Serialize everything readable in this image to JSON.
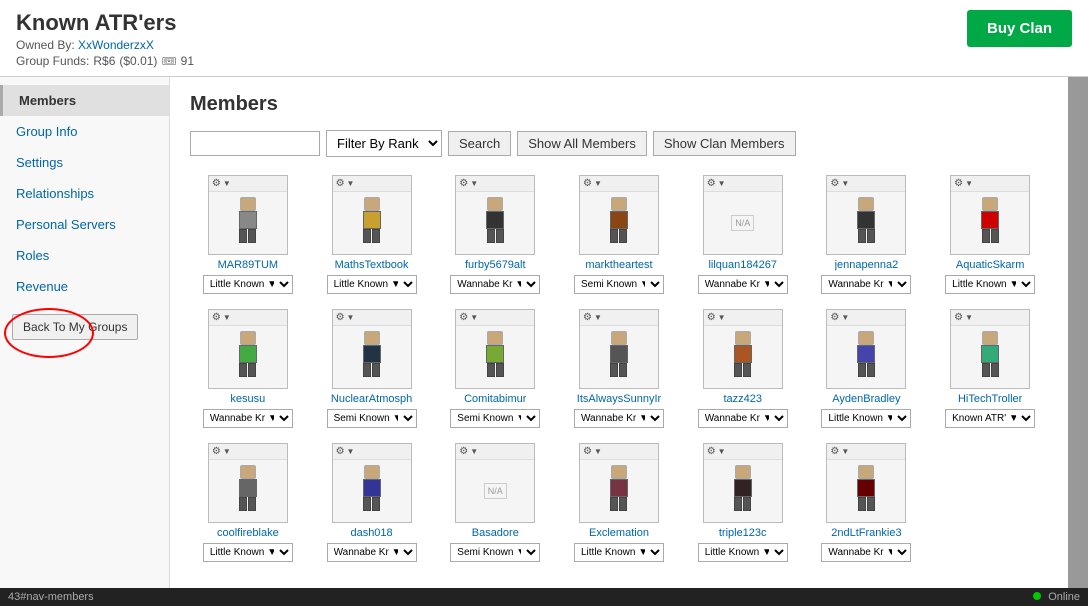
{
  "page": {
    "title": "Known ATR'ers",
    "owned_by_label": "Owned By:",
    "owned_by_user": "XxWonderzxX",
    "funds_label": "Group Funds:",
    "funds_robux": "R$6",
    "funds_usd": "($0.01)",
    "funds_tix": "91",
    "buy_clan_label": "Buy Clan"
  },
  "sidebar": {
    "items": [
      {
        "label": "Members",
        "active": true
      },
      {
        "label": "Group Info",
        "active": false
      },
      {
        "label": "Settings",
        "active": false
      },
      {
        "label": "Relationships",
        "active": false
      },
      {
        "label": "Personal Servers",
        "active": false
      },
      {
        "label": "Roles",
        "active": false
      },
      {
        "label": "Revenue",
        "active": false
      }
    ],
    "back_button_label": "Back To My Groups"
  },
  "members": {
    "title": "Members",
    "filter_placeholder": "",
    "filter_by_rank_label": "Filter By Rank",
    "search_label": "Search",
    "show_all_members_label": "Show All Members",
    "show_clan_members_label": "Show Clan Members",
    "rank_options": [
      "Little Known",
      "Wannabe Kr",
      "Semi Known",
      "Known ATR'",
      "Little Known",
      "Wannabe Kr"
    ],
    "rows": [
      {
        "members": [
          {
            "name": "MAR89TUM",
            "rank": "Little Known",
            "char_class": "char-body"
          },
          {
            "name": "MathsTextbook",
            "rank": "Little Known",
            "char_class": "char-body2"
          },
          {
            "name": "furby5679alt",
            "rank": "Wannabe Kr",
            "char_class": "char-body3"
          },
          {
            "name": "marktheartest",
            "rank": "Semi Known",
            "char_class": "char-body4"
          },
          {
            "name": "lilquan184267",
            "rank": "Wannabe Kr",
            "char_class": "char-body5",
            "na": true
          },
          {
            "name": "jennapenna2",
            "rank": "Wannabe Kr",
            "char_class": "char-body6"
          },
          {
            "name": "AquaticSkarm",
            "rank": "Little Known",
            "char_class": "char-body7"
          }
        ]
      },
      {
        "members": [
          {
            "name": "kesusu",
            "rank": "Wannabe Kr",
            "char_class": "char-body8"
          },
          {
            "name": "NuclearAtmosph",
            "rank": "Semi Known",
            "char_class": "char-body9"
          },
          {
            "name": "Comitabimur",
            "rank": "Semi Known",
            "char_class": "char-body10"
          },
          {
            "name": "ItsAlwaysSunnyIr",
            "rank": "Wannabe Kr",
            "char_class": "char-body11"
          },
          {
            "name": "tazz423",
            "rank": "Wannabe Kr",
            "char_class": "char-body12"
          },
          {
            "name": "AydenBradley",
            "rank": "Little Known",
            "char_class": "char-body13"
          },
          {
            "name": "HiTechTroller",
            "rank": "Known ATR'",
            "char_class": "char-body14"
          }
        ]
      },
      {
        "members": [
          {
            "name": "coolfireblake",
            "rank": "Little Known",
            "char_class": "char-body15"
          },
          {
            "name": "dash018",
            "rank": "Wannabe Kr",
            "char_class": "char-body16"
          },
          {
            "name": "Basadore",
            "rank": "Semi Known",
            "char_class": "char-body17",
            "na": true
          },
          {
            "name": "Exclemation",
            "rank": "Little Known",
            "char_class": "char-body18"
          },
          {
            "name": "triple123c",
            "rank": "Little Known",
            "char_class": "char-body19"
          },
          {
            "name": "2ndLtFrankie3",
            "rank": "Wannabe Kr",
            "char_class": "char-body20"
          }
        ]
      }
    ]
  },
  "status_bar": {
    "url_fragment": "43#nav-members",
    "online_label": "Online"
  }
}
